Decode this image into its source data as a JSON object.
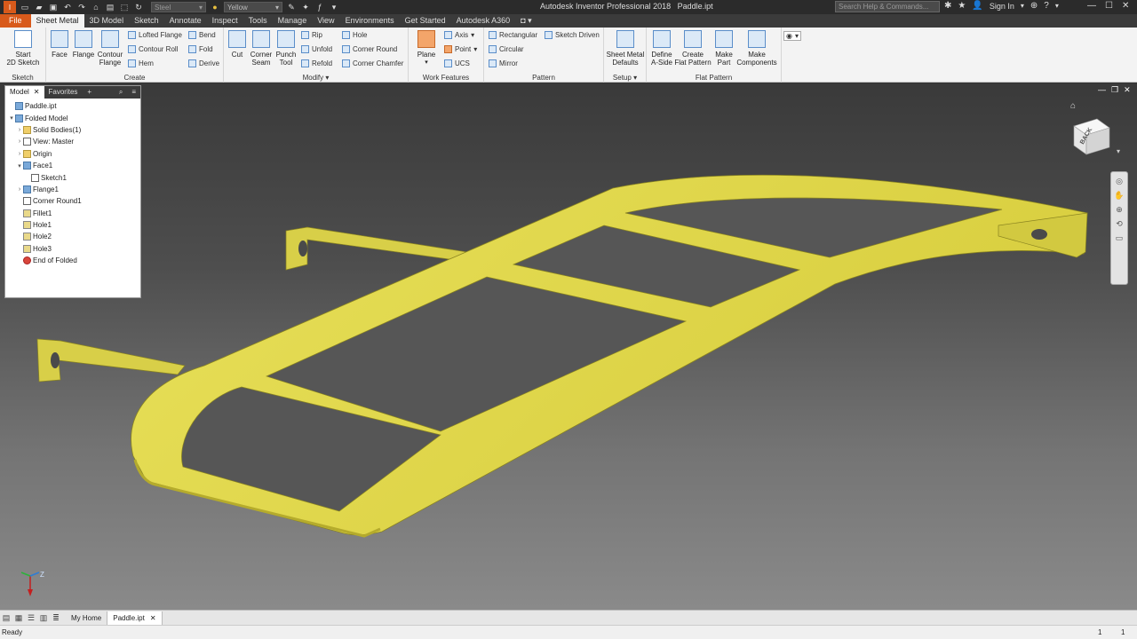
{
  "titlebar": {
    "app_title": "Autodesk Inventor Professional 2018",
    "doc_title": "Paddle.ipt",
    "material": "Steel",
    "appearance": "Yellow",
    "search_placeholder": "Search Help & Commands...",
    "sign_in": "Sign In"
  },
  "tabs": [
    "File",
    "Sheet Metal",
    "3D Model",
    "Sketch",
    "Annotate",
    "Inspect",
    "Tools",
    "Manage",
    "View",
    "Environments",
    "Get Started",
    "Autodesk A360"
  ],
  "active_tab": "Sheet Metal",
  "ribbon": {
    "sketch_panel": {
      "title": "Sketch",
      "start_sketch": "Start\n2D Sketch"
    },
    "create_panel": {
      "title": "Create",
      "face": "Face",
      "flange": "Flange",
      "contour_flange": "Contour\nFlange",
      "lofted_flange": "Lofted Flange",
      "contour_roll": "Contour Roll",
      "hem": "Hem",
      "bend": "Bend",
      "fold": "Fold",
      "derive": "Derive"
    },
    "modify_panel": {
      "title": "Modify",
      "cut": "Cut",
      "corner_seam": "Corner\nSeam",
      "punch_tool": "Punch\nTool",
      "rip": "Rip",
      "unfold": "Unfold",
      "refold": "Refold",
      "hole": "Hole",
      "corner_round": "Corner Round",
      "corner_chamfer": "Corner Chamfer"
    },
    "work_features_panel": {
      "title": "Work Features",
      "plane": "Plane",
      "axis": "Axis",
      "point": "Point",
      "ucs": "UCS"
    },
    "pattern_panel": {
      "title": "Pattern",
      "rectangular": "Rectangular",
      "circular": "Circular",
      "mirror": "Mirror",
      "sketch_driven": "Sketch Driven"
    },
    "setup_panel": {
      "title": "Setup",
      "defaults": "Sheet Metal\nDefaults"
    },
    "flat_pattern_panel": {
      "title": "Flat Pattern",
      "define_a_side": "Define\nA-Side",
      "create_flat_pattern": "Create\nFlat Pattern",
      "make_part": "Make\nPart",
      "make_components": "Make\nComponents"
    }
  },
  "browser": {
    "tabs": [
      "Model",
      "Favorites"
    ],
    "nodes": [
      {
        "label": "Paddle.ipt",
        "indent": 0,
        "expander": "",
        "icon": "part-icon"
      },
      {
        "label": "Folded Model",
        "indent": 0,
        "expander": "v",
        "icon": "folded-model-icon"
      },
      {
        "label": "Solid Bodies(1)",
        "indent": 1,
        "expander": ">",
        "icon": "solid-bodies-icon"
      },
      {
        "label": "View: Master",
        "indent": 1,
        "expander": ">",
        "icon": "view-icon"
      },
      {
        "label": "Origin",
        "indent": 1,
        "expander": ">",
        "icon": "folder-icon"
      },
      {
        "label": "Face1",
        "indent": 1,
        "expander": "v",
        "icon": "face-icon"
      },
      {
        "label": "Sketch1",
        "indent": 2,
        "expander": "",
        "icon": "sketch-icon"
      },
      {
        "label": "Flange1",
        "indent": 1,
        "expander": ">",
        "icon": "flange-icon"
      },
      {
        "label": "Corner Round1",
        "indent": 1,
        "expander": "",
        "icon": "corner-round-icon"
      },
      {
        "label": "Fillet1",
        "indent": 1,
        "expander": "",
        "icon": "fillet-icon"
      },
      {
        "label": "Hole1",
        "indent": 1,
        "expander": "",
        "icon": "hole-icon"
      },
      {
        "label": "Hole2",
        "indent": 1,
        "expander": "",
        "icon": "hole-icon"
      },
      {
        "label": "Hole3",
        "indent": 1,
        "expander": "",
        "icon": "hole-icon"
      },
      {
        "label": "End of Folded",
        "indent": 1,
        "expander": "",
        "icon": "end-of-part-icon"
      }
    ]
  },
  "viewcube_label": "BACK",
  "model_color": "#e8e05a",
  "doc_tabs": [
    "My Home",
    "Paddle.ipt"
  ],
  "status": {
    "text": "Ready",
    "count1": "1",
    "count2": "1"
  }
}
